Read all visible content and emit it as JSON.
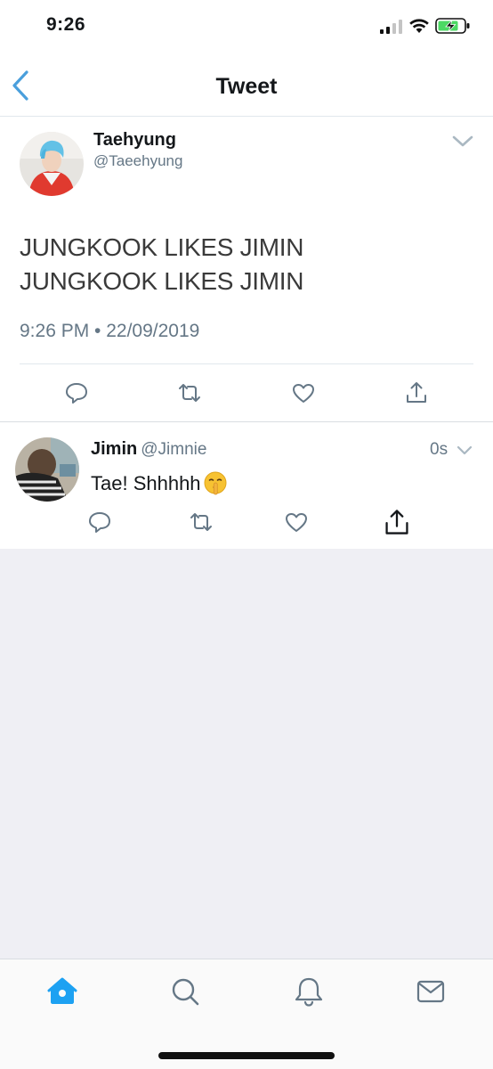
{
  "status_bar": {
    "time": "9:26"
  },
  "nav": {
    "title": "Tweet",
    "back_icon": "chevron-left-icon"
  },
  "tweet": {
    "author_name": "Taehyung",
    "author_handle": "@Taeehyung",
    "text_line1": "JUNGKOOK LIKES JIMIN",
    "text_line2": "JUNGKOOK LIKES JIMIN",
    "timestamp": "9:26 PM • 22/09/2019",
    "actions": [
      "reply-icon",
      "retweet-icon",
      "like-icon",
      "share-icon"
    ]
  },
  "reply": {
    "author_name": "Jimin",
    "author_handle": "@Jimnie",
    "time": "0s",
    "text": "Tae! Shhhhh",
    "emoji": "shushing-face-emoji",
    "actions": [
      "reply-icon",
      "retweet-icon",
      "like-icon",
      "share-icon"
    ]
  },
  "tab_bar": {
    "tabs": [
      "home-icon",
      "search-icon",
      "bell-icon",
      "mail-icon"
    ],
    "active": "home",
    "accent": "#1da1f2"
  },
  "colors": {
    "accent": "#1da1f2",
    "secondary_text": "#657786",
    "divider": "#e1e8ed",
    "empty_bg": "#efeff4"
  }
}
